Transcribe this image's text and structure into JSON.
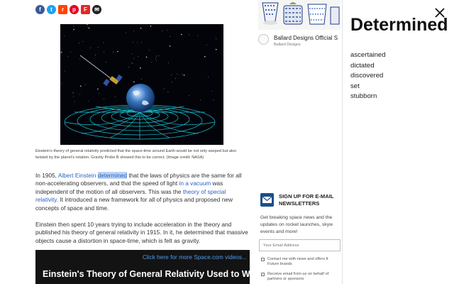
{
  "share_icons": [
    {
      "name": "facebook-icon",
      "glyph": "f",
      "color": "#3b5998"
    },
    {
      "name": "twitter-icon",
      "glyph": "t",
      "color": "#1da1f2"
    },
    {
      "name": "reddit-icon",
      "glyph": "r",
      "color": "#ff4500"
    },
    {
      "name": "pinterest-icon",
      "glyph": "p",
      "color": "#e60023"
    },
    {
      "name": "flipboard-icon",
      "glyph": "F",
      "color": "#e12828"
    },
    {
      "name": "email-icon",
      "glyph": "✉",
      "color": "#222222"
    }
  ],
  "figure": {
    "caption": "Einstein's theory of general relativity predicted that the space-time around Earth would be not only warped but also twisted by the planet's rotation. Gravity Probe B showed this to be correct. (Image credit: NASA)"
  },
  "article": {
    "p1": {
      "t1": "In 1905, ",
      "link1": "Albert Einstein",
      "t2": " ",
      "highlight": "determined",
      "t3": " that the laws of physics are the same for all non-accelerating observers, and that the speed of light ",
      "link2": "in a vacuum",
      "t4": " was independent of the motion of all observers. This was the ",
      "link3": "theory of special relativity",
      "t5": ". It introduced a new framework for all of physics and proposed new concepts of space and time."
    },
    "p2": "Einstein then spent 10 years trying to include acceleration in the theory and published his theory of general relativity in 1915. In it, he determined that massive objects cause a distortion in space-time, which is felt as gravity."
  },
  "video": {
    "link_text": "Click here for more Space.com videos...",
    "title": "Einstein's Theory of General Relativity Used to We..."
  },
  "ad": {
    "title": "Ballard Designs Official S",
    "subtitle": "Ballard Designs"
  },
  "newsletter": {
    "title_line1": "SIGN UP FOR E-MAIL",
    "title_line2": "NEWSLETTERS",
    "text_line1": "Get breaking space news and the",
    "text_line2": "updates on rocket launches, skyw",
    "text_line3": "events and more!",
    "email_placeholder": "Your Email Address",
    "check1_line1": "Contact me with news and offers fr",
    "check1_line2": "Future brands",
    "check2_line1": "Receive email from us on behalf of",
    "check2_line2": "partners or sponsors"
  },
  "dictionary": {
    "word": "Determined",
    "synonyms": [
      "ascertained",
      "dictated",
      "discovered",
      "set",
      "stubborn"
    ]
  }
}
